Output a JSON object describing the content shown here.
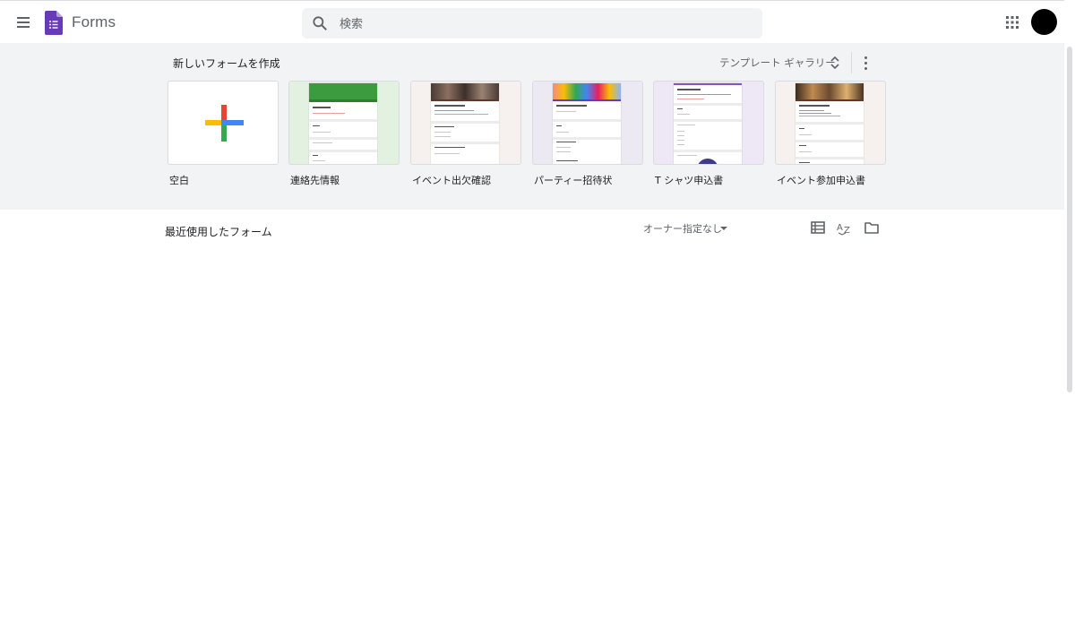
{
  "header": {
    "app_name": "Forms",
    "search_placeholder": "検索"
  },
  "templates_section": {
    "title": "新しいフォームを作成",
    "gallery_label": "テンプレート ギャラリー",
    "templates": [
      {
        "label": "空白"
      },
      {
        "label": "連絡先情報",
        "accent": "#34a853"
      },
      {
        "label": "イベント出欠確認",
        "accent": "#5b3a29"
      },
      {
        "label": "パーティー招待状",
        "accent": "#673ab7"
      },
      {
        "label": "T シャツ申込書",
        "accent": "#7e57c2"
      },
      {
        "label": "イベント参加申込書",
        "accent": "#5b3a29"
      }
    ]
  },
  "recent_section": {
    "title": "最近使用したフォーム",
    "owner_filter": "オーナー指定なし"
  },
  "colors": {
    "forms_purple": "#673ab7",
    "gallery_bg": "#f1f3f4",
    "plus_red": "#ea4335",
    "plus_blue": "#4285f4",
    "plus_yellow": "#fbbc04",
    "plus_green": "#34a853"
  }
}
